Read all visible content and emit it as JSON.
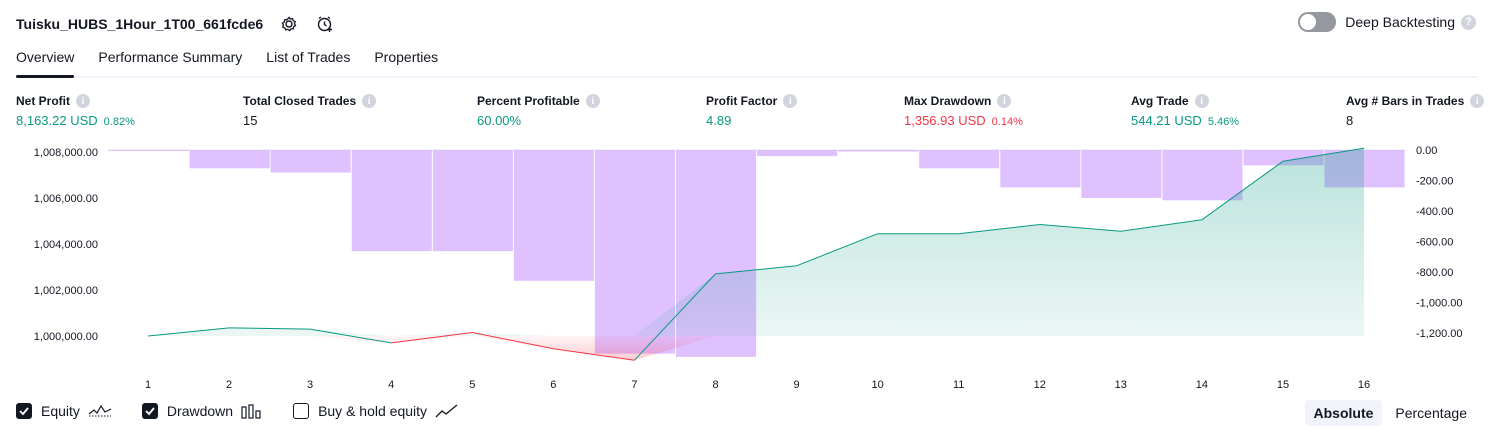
{
  "header": {
    "title": "Tuisku_HUBS_1Hour_1T00_661fcde6",
    "deep_backtesting_label": "Deep Backtesting",
    "deep_backtesting_on": false
  },
  "tabs": [
    {
      "label": "Overview",
      "active": true
    },
    {
      "label": "Performance Summary",
      "active": false
    },
    {
      "label": "List of Trades",
      "active": false
    },
    {
      "label": "Properties",
      "active": false
    }
  ],
  "metrics": [
    {
      "label": "Net Profit",
      "value": "8,163.22 USD",
      "pct": "0.82%",
      "tone": "pos"
    },
    {
      "label": "Total Closed Trades",
      "value": "15",
      "pct": "",
      "tone": "neutral"
    },
    {
      "label": "Percent Profitable",
      "value": "60.00%",
      "pct": "",
      "tone": "pos"
    },
    {
      "label": "Profit Factor",
      "value": "4.89",
      "pct": "",
      "tone": "pos"
    },
    {
      "label": "Max Drawdown",
      "value": "1,356.93 USD",
      "pct": "0.14%",
      "tone": "neg"
    },
    {
      "label": "Avg Trade",
      "value": "544.21 USD",
      "pct": "5.46%",
      "tone": "pos"
    },
    {
      "label": "Avg # Bars in Trades",
      "value": "8",
      "pct": "",
      "tone": "neutral"
    }
  ],
  "chart_data": {
    "type": "line",
    "x": [
      1,
      2,
      3,
      4,
      5,
      6,
      7,
      8,
      9,
      10,
      11,
      12,
      13,
      14,
      15,
      16
    ],
    "series": [
      {
        "name": "Equity",
        "type": "area",
        "axis": "left",
        "values": [
          1000000,
          1000350,
          1000300,
          999700,
          1000150,
          999450,
          998950,
          1002700,
          1003050,
          1004450,
          1004450,
          1004850,
          1004550,
          1005050,
          1007600,
          1008163.22
        ],
        "color_up": "#089981",
        "color_down": "#f23645"
      },
      {
        "name": "Drawdown",
        "type": "bar",
        "axis": "right",
        "values": [
          -5,
          -120,
          -148,
          -663,
          -663,
          -858,
          -1336,
          -1357,
          -40,
          -10,
          -120,
          -245,
          -315,
          -330,
          -100,
          -245
        ],
        "color": "#d1a7ff"
      }
    ],
    "left_axis": {
      "ticks": [
        "1,008,000.00",
        "1,006,000.00",
        "1,004,000.00",
        "1,002,000.00",
        "1,000,000.00"
      ],
      "min": 998500,
      "max": 1008000
    },
    "right_axis": {
      "ticks": [
        "0.00",
        "-200.00",
        "-400.00",
        "-600.00",
        "-800.00",
        "-1,000.00",
        "-1,200.00"
      ],
      "min": -1370,
      "max": 0
    }
  },
  "footer": {
    "checkboxes": [
      {
        "label": "Equity",
        "checked": true
      },
      {
        "label": "Drawdown",
        "checked": true
      },
      {
        "label": "Buy & hold equity",
        "checked": false
      }
    ],
    "modes": [
      {
        "label": "Absolute",
        "active": true
      },
      {
        "label": "Percentage",
        "active": false
      }
    ]
  }
}
